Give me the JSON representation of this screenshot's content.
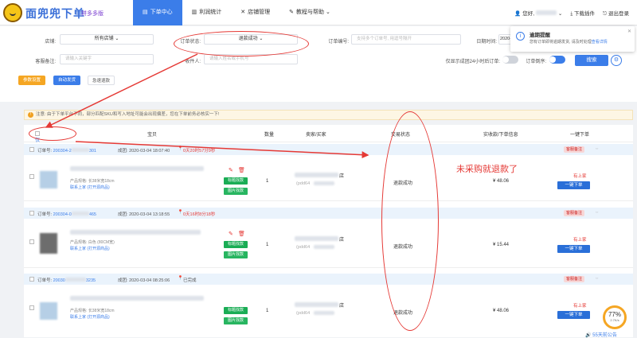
{
  "brand": {
    "name": "面兜兜下单",
    "subtitle": "拼多多版"
  },
  "nav": [
    {
      "label": "下单中心",
      "icon": "order-icon"
    },
    {
      "label": "利润统计",
      "icon": "chart-icon"
    },
    {
      "label": "店铺管理",
      "icon": "tools-icon"
    },
    {
      "label": "教程与帮助",
      "icon": "book-icon"
    }
  ],
  "user": {
    "greeting": "您好,",
    "download": "下载插件",
    "logout": "退出登录"
  },
  "filters": {
    "shop_label": "店铺:",
    "shop_value": "所有店铺",
    "status_label": "订单状态:",
    "status_value": "退款成功",
    "order_no_label": "订单编号:",
    "order_no_placeholder": "支持多个订单号, 用逗号隔开",
    "date_label": "日期时间:",
    "date_value": "2020-",
    "remark_label": "客服备注:",
    "remark_placeholder": "请输入关键字",
    "receiver_label": "收件人:",
    "receiver_placeholder": "请输入姓名或手机号",
    "only_24h_label": "仅显示成团24小时后订单:",
    "order_reverse_label": "订单倒序:",
    "order_reverse_value": "开",
    "search_button": "搜索",
    "buttons": {
      "params": "参数设置",
      "auto_ship": "自动发货",
      "refund": "急速退款"
    }
  },
  "popup": {
    "title": "逾期提醒",
    "text": "您有订单即将逾期发货, 请及时处理",
    "link": "查看详情"
  },
  "alert": "注意: 由于下单平台不同，部分匹配SKU和写入地址可能会出现偏差，您在下单前务必核实一下!",
  "table": {
    "only_unordered": "仅显示已下单的",
    "columns": {
      "product": "宝贝",
      "qty": "数量",
      "buyer": "卖家/买家",
      "status": "交易状态",
      "paid": "实收款/下单信息",
      "action": "一键下单"
    }
  },
  "orders": [
    {
      "order_no_prefix": "订单号:",
      "order_no": "200304-2",
      "order_no_tail": "301",
      "time_label": "成团:",
      "time": "2020-03-04 18:07:40",
      "countdown": "0天20时57分9秒",
      "spec_label": "产品规格: 长38米宽18cm",
      "link": "联系上家 (打开源商品)",
      "tag1": "标题找款",
      "tag2": "图片找款",
      "qty": "1",
      "shop_char": "店",
      "pdd": "(pdd64",
      "status": "退款成功",
      "price": "¥ 48.06",
      "badge": "客服备注",
      "has_upstream": "有上家",
      "buy": "一键下单"
    },
    {
      "order_no_prefix": "订单号:",
      "order_no": "200304-0",
      "order_no_tail": "465",
      "time_label": "成团:",
      "time": "2020-03-04 13:18:55",
      "countdown": "0天16时8分18秒",
      "spec_label": "产品规格: 白色 (80CM宽)",
      "link": "联系上家 (打开源商品)",
      "tag1": "标题找款",
      "tag2": "图片找款",
      "qty": "1",
      "shop_char": "店",
      "pdd": "(pdd64",
      "status": "退款成功",
      "price": "¥ 15.44",
      "badge": "客服备注",
      "has_upstream": "有上家",
      "buy": "一键下单"
    },
    {
      "order_no_prefix": "订单号:",
      "order_no": "20030",
      "order_no_tail": "3235",
      "time_label": "成团:",
      "time": "2020-03-04 08:25:06",
      "countdown": "已完成",
      "spec_label": "产品规格: 长38米宽18cm",
      "link": "联系上家 (打开源商品)",
      "tag1": "标题找款",
      "tag2": "图片找款",
      "qty": "1",
      "shop_char": "店",
      "pdd": "(pdd64",
      "status": "退款成功",
      "price": "¥ 48.06",
      "badge": "客服备注",
      "has_upstream": "有上家",
      "buy": "一键下单"
    }
  ],
  "annotation": "未采购就退款了",
  "progress": {
    "percent": "77%",
    "rate": "2.7K/s"
  },
  "footer_notice": "55天前公告",
  "colors": {
    "primary": "#3b7de9",
    "annotation": "#e53935",
    "green": "#1aad55",
    "orange": "#f5a623"
  }
}
